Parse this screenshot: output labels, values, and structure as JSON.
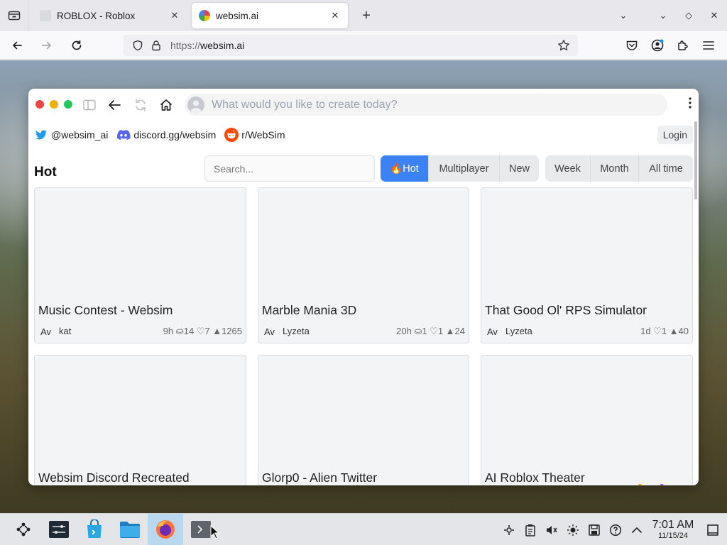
{
  "browser": {
    "tabs": [
      {
        "title": "ROBLOX - Roblox",
        "active": false
      },
      {
        "title": "websim.ai",
        "active": true
      }
    ],
    "url_prefix": "https://",
    "url_domain": "websim.ai"
  },
  "websim": {
    "prompt_placeholder": "What would you like to create today?",
    "links": [
      {
        "label": "@websim_ai",
        "icon": "twitter-icon"
      },
      {
        "label": "discord.gg/websim",
        "icon": "discord-icon"
      },
      {
        "label": "r/WebSim",
        "icon": "reddit-icon"
      }
    ],
    "login_label": "Login",
    "section_title": "Hot",
    "search_placeholder": "Search...",
    "feed_tabs": [
      {
        "label": "🔥Hot",
        "selected": true
      },
      {
        "label": "Multiplayer",
        "selected": false
      },
      {
        "label": "New",
        "selected": false
      }
    ],
    "period_tabs": [
      {
        "label": "Week"
      },
      {
        "label": "Month"
      },
      {
        "label": "All time"
      }
    ],
    "cards": [
      {
        "title": "Music Contest - Websim",
        "avatar": "Av",
        "author": "kat",
        "stats": "9h ⛀14 ♡7 ▲1265"
      },
      {
        "title": "Marble Mania 3D",
        "avatar": "Av",
        "author": "Lyzeta",
        "stats": "20h ⛀1 ♡1 ▲24"
      },
      {
        "title": "That Good Ol' RPS Simulator",
        "avatar": "Av",
        "author": "Lyzeta",
        "stats": "1d ♡1 ▲40"
      },
      {
        "title": "Websim Discord Recreated",
        "avatar": "",
        "author": "",
        "stats": ""
      },
      {
        "title": "Glorp0 - Alien Twitter",
        "avatar": "",
        "author": "",
        "stats": ""
      },
      {
        "title": "AI Roblox Theater",
        "avatar": "",
        "author": "",
        "stats": ""
      }
    ],
    "watermark": "websim",
    "accent": "#3b82f6"
  },
  "taskbar": {
    "time": "7:01 AM",
    "date": "11/15/24"
  }
}
